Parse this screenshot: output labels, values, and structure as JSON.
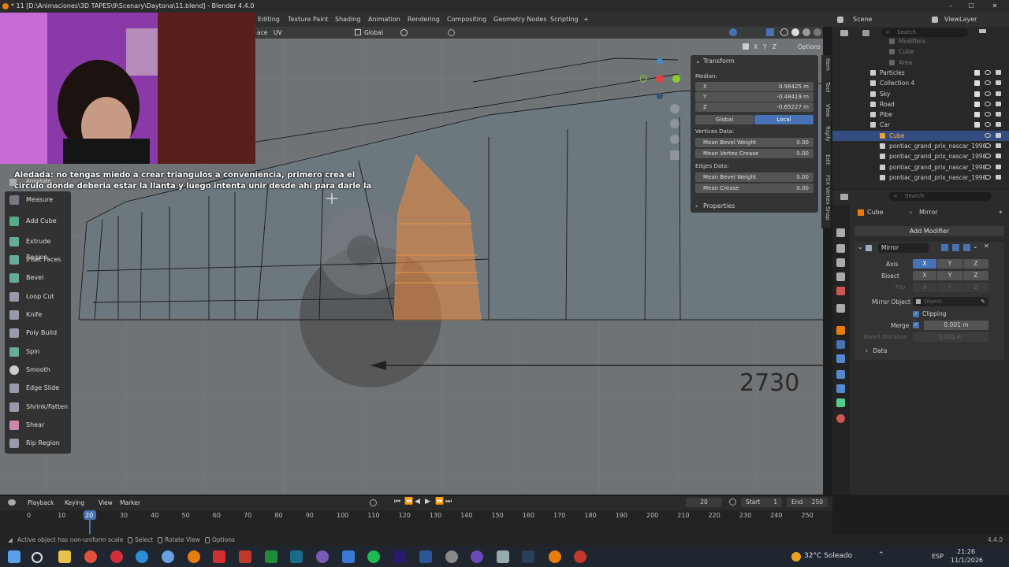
{
  "window": {
    "title": "* 11 [D:\\Animaciones\\3D TAPES\\9\\Scenary\\Daytona\\11.blend] - Blender 4.4.0"
  },
  "menubar": {
    "workspaces": [
      "Editing",
      "Texture Paint",
      "Shading",
      "Animation",
      "Rendering",
      "Compositing",
      "Geometry Nodes",
      "Scripting"
    ],
    "add_tab": "+",
    "scene": "Scene",
    "view_layer": "ViewLayer"
  },
  "viewport_header": {
    "menu_face": "ace",
    "menu_uv": "UV",
    "orientation": "Global",
    "options": "Options",
    "axes": [
      "X",
      "Y",
      "Z"
    ]
  },
  "caption": "Aledada: no tengas miedo a crear triangulos a conveniencia, primero crea el circulo donde deberia estar la llanta y luego intenta unir desde ahi para darle la forma",
  "toolbar": {
    "annotate": "Annotate",
    "items": [
      "Measure",
      "Add Cube",
      "Extrude Region",
      "Inset Faces",
      "Bevel",
      "Loop Cut",
      "Knife",
      "Poly Build",
      "Spin",
      "Smooth",
      "Edge Slide",
      "Shrink/Fatten",
      "Shear",
      "Rip Region"
    ]
  },
  "viewport": {
    "dimension_label": "2730"
  },
  "transform_panel": {
    "title": "Transform",
    "median_label": "Median:",
    "x_label": "X",
    "x_value": "0.98425 m",
    "y_label": "Y",
    "y_value": "-0.48419 m",
    "z_label": "Z",
    "z_value": "-0.65227 m",
    "global": "Global",
    "local": "Local",
    "vertices_data": "Vertices Data:",
    "mean_bevel_weight_v": "Mean Bevel Weight",
    "mean_bevel_weight_v_val": "0.00",
    "mean_vertex_crease": "Mean Vertex Crease",
    "mean_vertex_crease_val": "0.00",
    "edges_data": "Edges Data:",
    "mean_bevel_weight_e": "Mean Bevel Weight",
    "mean_bevel_weight_e_val": "0.00",
    "mean_crease": "Mean Crease",
    "mean_crease_val": "0.00",
    "properties": "Properties"
  },
  "side_tabs": [
    "Item",
    "Tool",
    "View",
    "Rigify",
    "Edit",
    "FSX Vertex Snap"
  ],
  "outliner": {
    "search_placeholder": "Search",
    "rows": [
      {
        "name": "Modifiers",
        "indent": 6,
        "sel": false,
        "dim": true
      },
      {
        "name": "Cube",
        "indent": 6,
        "sel": false,
        "dim": true
      },
      {
        "name": "Area",
        "indent": 6,
        "sel": false,
        "dim": true
      },
      {
        "name": "Particles",
        "indent": 2,
        "sel": false,
        "dim": false
      },
      {
        "name": "Collection 4",
        "indent": 2,
        "sel": false,
        "dim": false
      },
      {
        "name": "Sky",
        "indent": 2,
        "sel": false,
        "dim": false
      },
      {
        "name": "Road",
        "indent": 2,
        "sel": false,
        "dim": false
      },
      {
        "name": "Pibe",
        "indent": 2,
        "sel": false,
        "dim": false
      },
      {
        "name": "Car",
        "indent": 2,
        "sel": false,
        "dim": false
      },
      {
        "name": "Cube",
        "indent": 4,
        "sel": true,
        "dim": false
      },
      {
        "name": "pontiac_grand_prix_nascar_1990",
        "indent": 4,
        "sel": false,
        "dim": false
      },
      {
        "name": "pontiac_grand_prix_nascar_1990.",
        "indent": 4,
        "sel": false,
        "dim": false
      },
      {
        "name": "pontiac_grand_prix_nascar_1990.",
        "indent": 4,
        "sel": false,
        "dim": false
      },
      {
        "name": "pontiac_grand_prix_nascar_1990.",
        "indent": 4,
        "sel": false,
        "dim": false
      }
    ]
  },
  "properties": {
    "search_placeholder": "Search",
    "breadcrumb_object": "Cube",
    "breadcrumb_modifier": "Mirror",
    "add_modifier": "Add Modifier",
    "modifier_name": "Mirror",
    "axis_label": "Axis",
    "bisect_label": "Bisect",
    "flip_label": "Flip",
    "x": "X",
    "y": "Y",
    "z": "Z",
    "mirror_object_label": "Mirror Object",
    "mirror_object_placeholder": "Object",
    "clipping": "Clipping",
    "merge_label": "Merge",
    "merge_value": "0.001 m",
    "bisect_distance_label": "Bisect Distance",
    "bisect_distance_value": "0.001 m",
    "data": "Data"
  },
  "timeline": {
    "playback": "Playback",
    "keying": "Keying",
    "view": "View",
    "marker": "Marker",
    "current_frame": "20",
    "start_label": "Start",
    "start": "1",
    "end_label": "End",
    "end": "250",
    "frames": [
      "0",
      "10",
      "20",
      "30",
      "40",
      "50",
      "60",
      "70",
      "80",
      "90",
      "100",
      "110",
      "120",
      "130",
      "140",
      "150",
      "160",
      "170",
      "180",
      "190",
      "200",
      "210",
      "220",
      "230",
      "240",
      "250"
    ]
  },
  "statusbar": {
    "message": "Active object has non-uniform scale",
    "select": "Select",
    "rotate_view": "Rotate View",
    "options": "Options",
    "version": "4.4.0"
  },
  "taskbar": {
    "weather": "32°C Soleado",
    "language": "ESP",
    "time": "21:26",
    "date": "11/1/2026"
  },
  "colors": {
    "accent": "#4772b3",
    "selection_orange": "#f08a3a",
    "viewport_bg": "#6f7275"
  }
}
